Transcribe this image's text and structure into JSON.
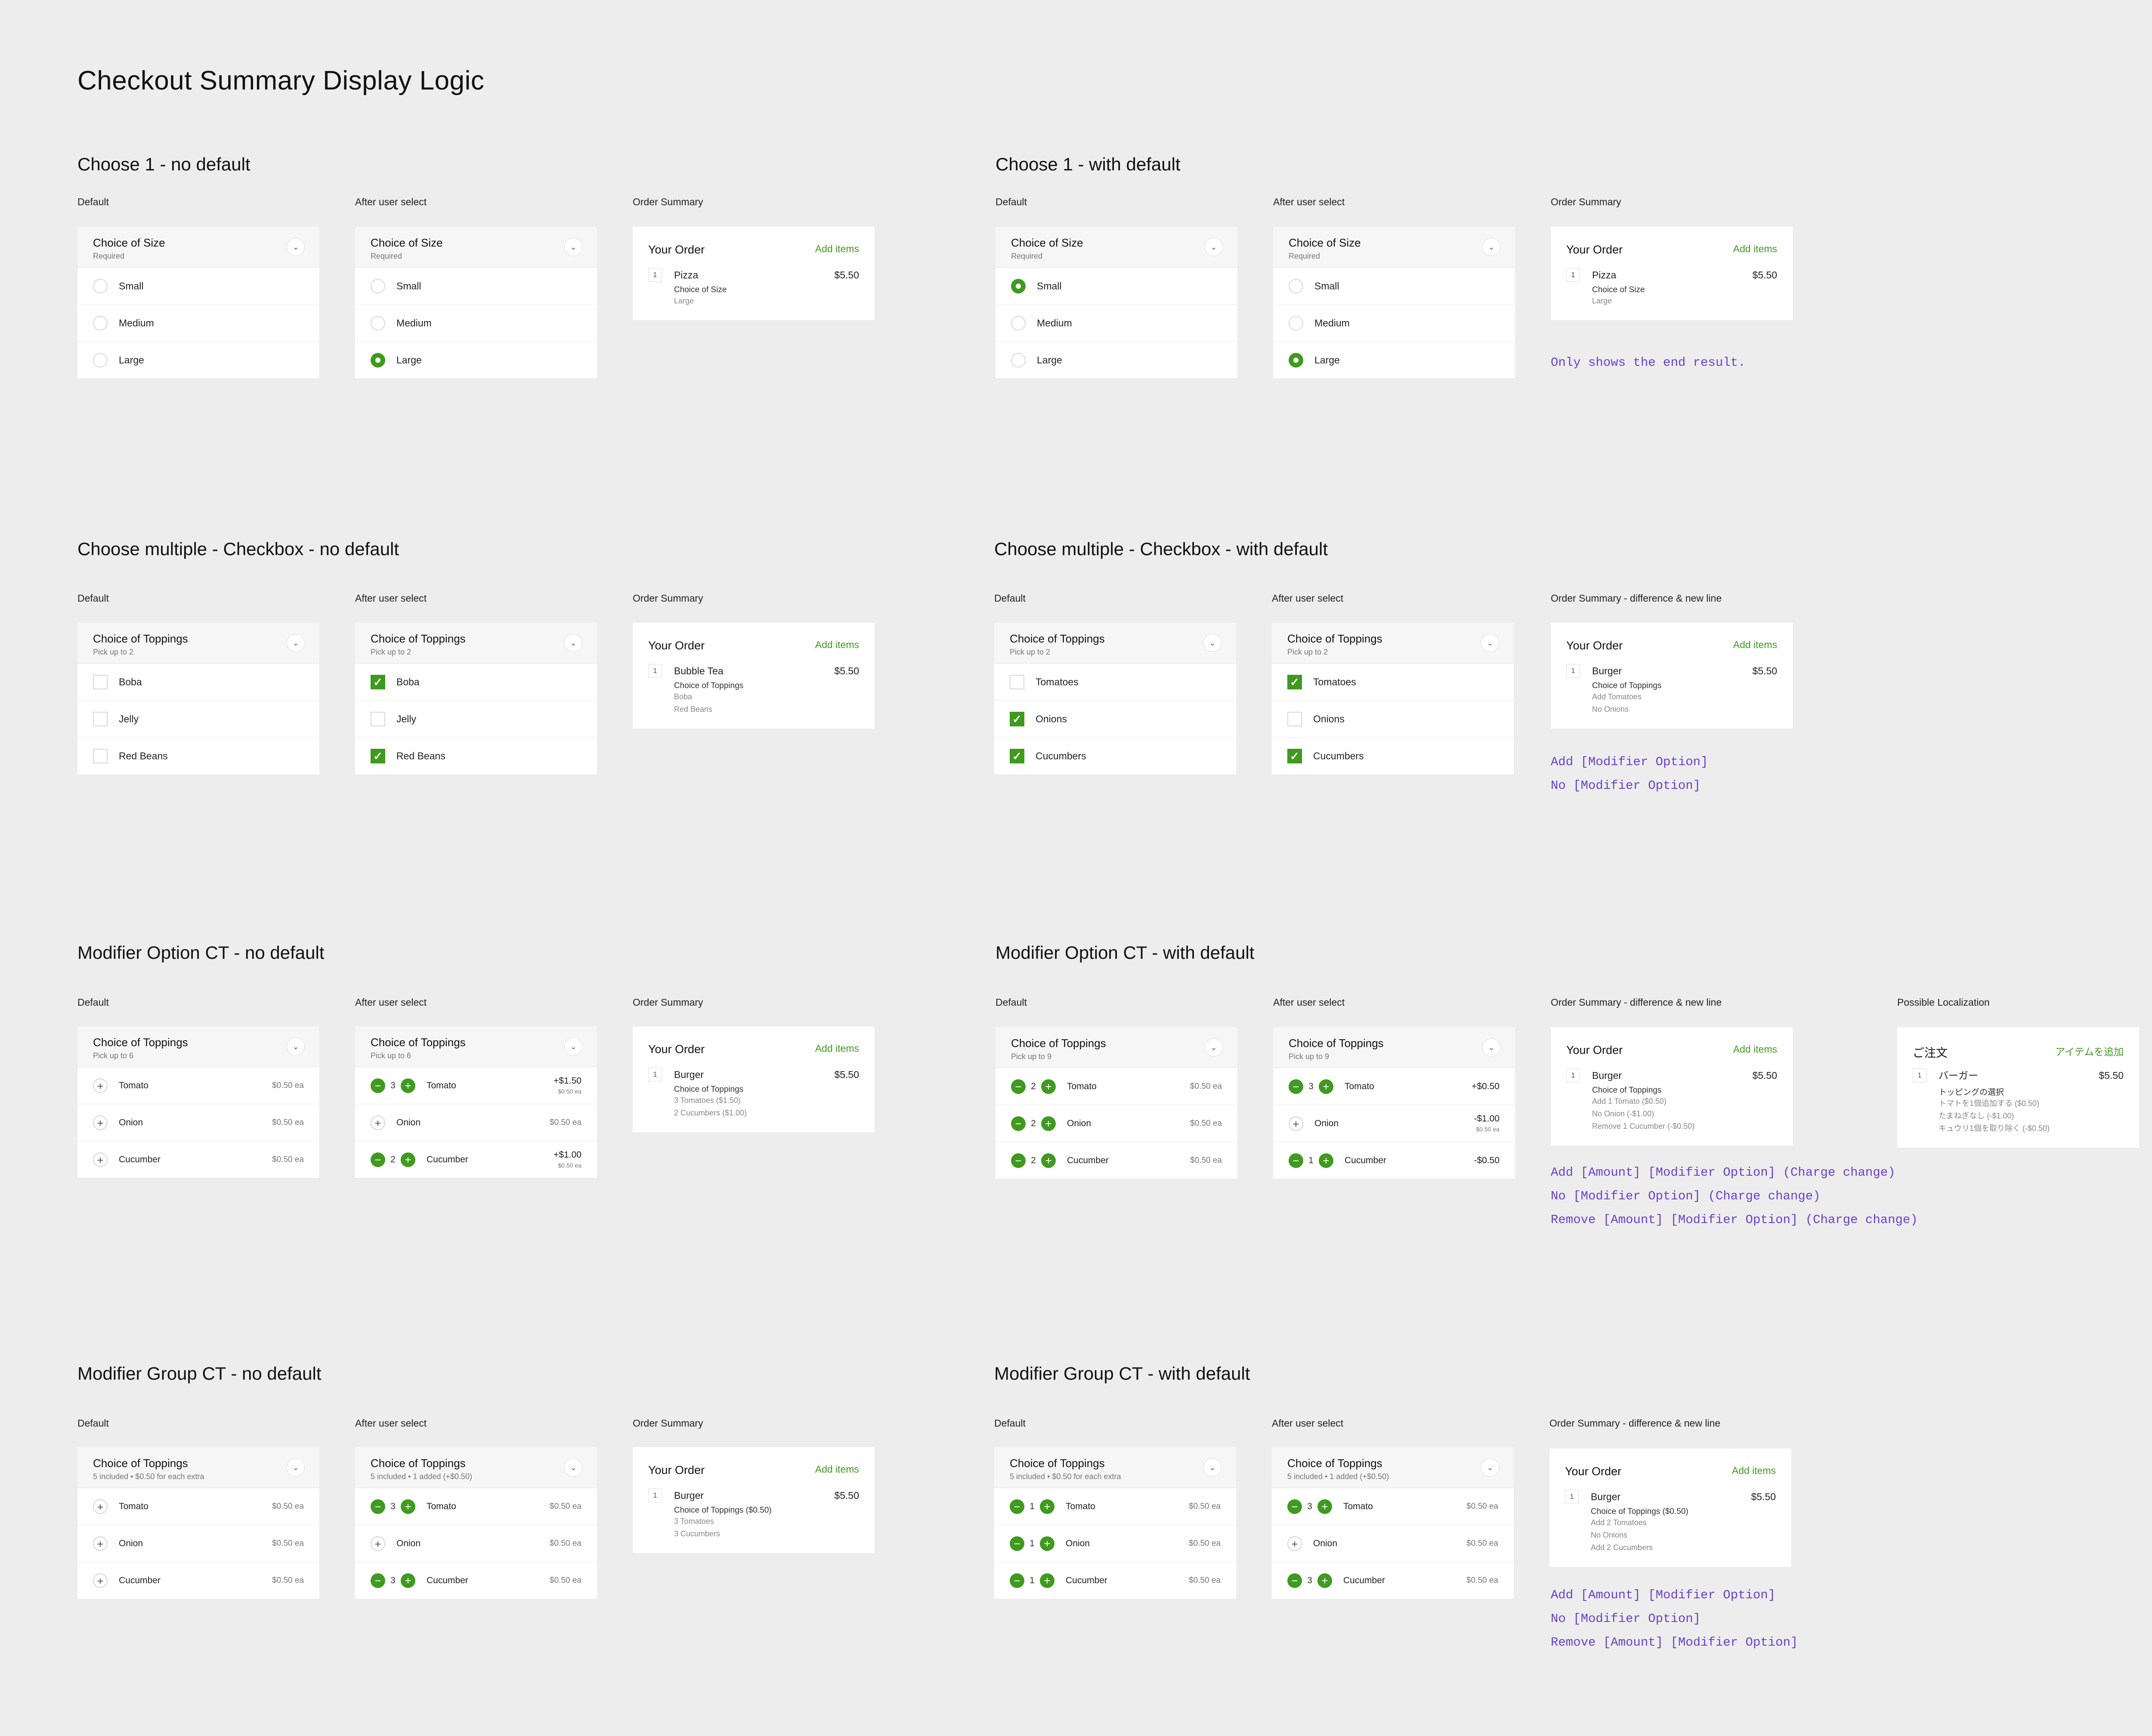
{
  "page_title": "Checkout Summary Display Logic",
  "labels": {
    "default": "Default",
    "after": "After user select",
    "order_summary": "Order Summary",
    "order_summary_diff": "Order Summary - difference & new line",
    "localization": "Possible Localization"
  },
  "accent_color": "#3f9a1f",
  "note_color": "#6a3fd0",
  "sections": {
    "c1_nodef": {
      "title": "Choose 1 - no default",
      "group": {
        "title": "Choice of Size",
        "subtitle": "Required"
      },
      "options": [
        "Small",
        "Medium",
        "Large"
      ],
      "default_selected": [
        false,
        false,
        false
      ],
      "after_selected": [
        false,
        false,
        true
      ],
      "summary": {
        "heading": "Your Order",
        "add": "Add items",
        "qty": "1",
        "item": "Pizza",
        "price": "$5.50",
        "group": "Choice of Size",
        "details": [
          "Large"
        ]
      }
    },
    "c1_def": {
      "title": "Choose 1 - with default",
      "group": {
        "title": "Choice of Size",
        "subtitle": "Required"
      },
      "options": [
        "Small",
        "Medium",
        "Large"
      ],
      "default_selected": [
        true,
        false,
        false
      ],
      "after_selected": [
        false,
        false,
        true
      ],
      "summary": {
        "heading": "Your Order",
        "add": "Add items",
        "qty": "1",
        "item": "Pizza",
        "price": "$5.50",
        "group": "Choice of Size",
        "details": [
          "Large"
        ]
      },
      "notes": [
        "Only shows the end result."
      ]
    },
    "cm_nodef": {
      "title": "Choose multiple - Checkbox - no default",
      "group": {
        "title": "Choice of Toppings",
        "subtitle": "Pick up to 2"
      },
      "options": [
        "Boba",
        "Jelly",
        "Red Beans"
      ],
      "default_checked": [
        false,
        false,
        false
      ],
      "after_checked": [
        true,
        false,
        true
      ],
      "summary": {
        "heading": "Your Order",
        "add": "Add items",
        "qty": "1",
        "item": "Bubble Tea",
        "price": "$5.50",
        "group": "Choice of Toppings",
        "details": [
          "Boba",
          "Red Beans"
        ]
      }
    },
    "cm_def": {
      "title": "Choose multiple - Checkbox - with default",
      "group": {
        "title": "Choice of Toppings",
        "subtitle": "Pick up to 2"
      },
      "options": [
        "Tomatoes",
        "Onions",
        "Cucumbers"
      ],
      "default_checked": [
        false,
        true,
        true
      ],
      "after_checked": [
        true,
        false,
        true
      ],
      "summary": {
        "heading": "Your Order",
        "add": "Add items",
        "qty": "1",
        "item": "Burger",
        "price": "$5.50",
        "group": "Choice of Toppings",
        "details": [
          "Add Tomatoes",
          "No Onions"
        ]
      },
      "notes": [
        "Add [Modifier Option]",
        "No [Modifier Option]"
      ]
    },
    "mo_nodef": {
      "title": "Modifier Option CT - no default",
      "group": {
        "title": "Choice of Toppings",
        "subtitle": "Pick up to 6"
      },
      "default_rows": [
        {
          "label": "Tomato",
          "price": "$0.50 ea"
        },
        {
          "label": "Onion",
          "price": "$0.50 ea"
        },
        {
          "label": "Cucumber",
          "price": "$0.50 ea"
        }
      ],
      "after_rows": [
        {
          "label": "Tomato",
          "qty": "3",
          "change": "+$1.50",
          "each": "$0.50 ea"
        },
        {
          "label": "Onion",
          "price": "$0.50 ea"
        },
        {
          "label": "Cucumber",
          "qty": "2",
          "change": "+$1.00",
          "each": "$0.50 ea"
        }
      ],
      "summary": {
        "heading": "Your Order",
        "add": "Add items",
        "qty": "1",
        "item": "Burger",
        "price": "$5.50",
        "group": "Choice of Toppings",
        "details": [
          "3 Tomatoes ($1.50)",
          "2 Cucumbers ($1.00)"
        ]
      }
    },
    "mo_def": {
      "title": "Modifier Option CT - with default",
      "group": {
        "title": "Choice of Toppings",
        "subtitle": "Pick up to 9"
      },
      "default_rows": [
        {
          "label": "Tomato",
          "qty": "2",
          "price": "$0.50 ea"
        },
        {
          "label": "Onion",
          "qty": "2",
          "price": "$0.50 ea"
        },
        {
          "label": "Cucumber",
          "qty": "2",
          "price": "$0.50 ea"
        }
      ],
      "after_rows": [
        {
          "label": "Tomato",
          "qty": "3",
          "change": "+$0.50"
        },
        {
          "label": "Onion",
          "change": "-$1.00",
          "each": "$0.50 ea"
        },
        {
          "label": "Cucumber",
          "qty": "1",
          "change": "-$0.50"
        }
      ],
      "summary": {
        "heading": "Your Order",
        "add": "Add items",
        "qty": "1",
        "item": "Burger",
        "price": "$5.50",
        "group": "Choice of Toppings",
        "details": [
          "Add 1 Tomato ($0.50)",
          "No Onion (-$1.00)",
          "Remove 1 Cucumber (-$0.50)"
        ]
      },
      "localized": {
        "heading": "ご注文",
        "add": "アイテムを追加",
        "qty": "1",
        "item": "バーガー",
        "price": "$5.50",
        "group": "トッピングの選択",
        "details": [
          "トマトを1個追加する ($0.50)",
          "たまねぎなし (-$1.00)",
          "キュウリ1個を取り除く (-$0.50)"
        ]
      },
      "notes": [
        "Add [Amount] [Modifier Option] (Charge change)",
        "No [Modifier Option] (Charge change)",
        "Remove [Amount] [Modifier Option] (Charge change)"
      ]
    },
    "mg_nodef": {
      "title": "Modifier Group CT - no default",
      "group": {
        "title": "Choice of Toppings",
        "subtitle": "5 included • $0.50 for each extra"
      },
      "after_subtitle": "5 included • 1 added (+$0.50)",
      "default_rows": [
        {
          "label": "Tomato",
          "price": "$0.50 ea"
        },
        {
          "label": "Onion",
          "price": "$0.50 ea"
        },
        {
          "label": "Cucumber",
          "price": "$0.50 ea"
        }
      ],
      "after_rows": [
        {
          "label": "Tomato",
          "qty": "3",
          "price": "$0.50 ea"
        },
        {
          "label": "Onion",
          "price": "$0.50 ea"
        },
        {
          "label": "Cucumber",
          "qty": "3",
          "price": "$0.50 ea"
        }
      ],
      "summary": {
        "heading": "Your Order",
        "add": "Add items",
        "qty": "1",
        "item": "Burger",
        "price": "$5.50",
        "group": "Choice of Toppings ($0.50)",
        "details": [
          "3 Tomatoes",
          "3 Cucumbers"
        ]
      }
    },
    "mg_def": {
      "title": "Modifier Group CT - with default",
      "group": {
        "title": "Choice of Toppings",
        "subtitle": "5 included • $0.50 for each extra"
      },
      "after_subtitle": "5 included • 1 added (+$0.50)",
      "default_rows": [
        {
          "label": "Tomato",
          "qty": "1",
          "price": "$0.50 ea"
        },
        {
          "label": "Onion",
          "qty": "1",
          "price": "$0.50 ea"
        },
        {
          "label": "Cucumber",
          "qty": "1",
          "price": "$0.50 ea"
        }
      ],
      "after_rows": [
        {
          "label": "Tomato",
          "qty": "3",
          "price": "$0.50 ea"
        },
        {
          "label": "Onion",
          "price": "$0.50 ea"
        },
        {
          "label": "Cucumber",
          "qty": "3",
          "price": "$0.50 ea"
        }
      ],
      "summary": {
        "heading": "Your Order",
        "add": "Add items",
        "qty": "1",
        "item": "Burger",
        "price": "$5.50",
        "group": "Choice of Toppings ($0.50)",
        "details": [
          "Add 2 Tomatoes",
          "No Onions",
          "Add 2 Cucumbers"
        ]
      },
      "notes": [
        "Add [Amount] [Modifier Option]",
        "No [Modifier Option]",
        "Remove [Amount] [Modifier Option]"
      ]
    }
  }
}
